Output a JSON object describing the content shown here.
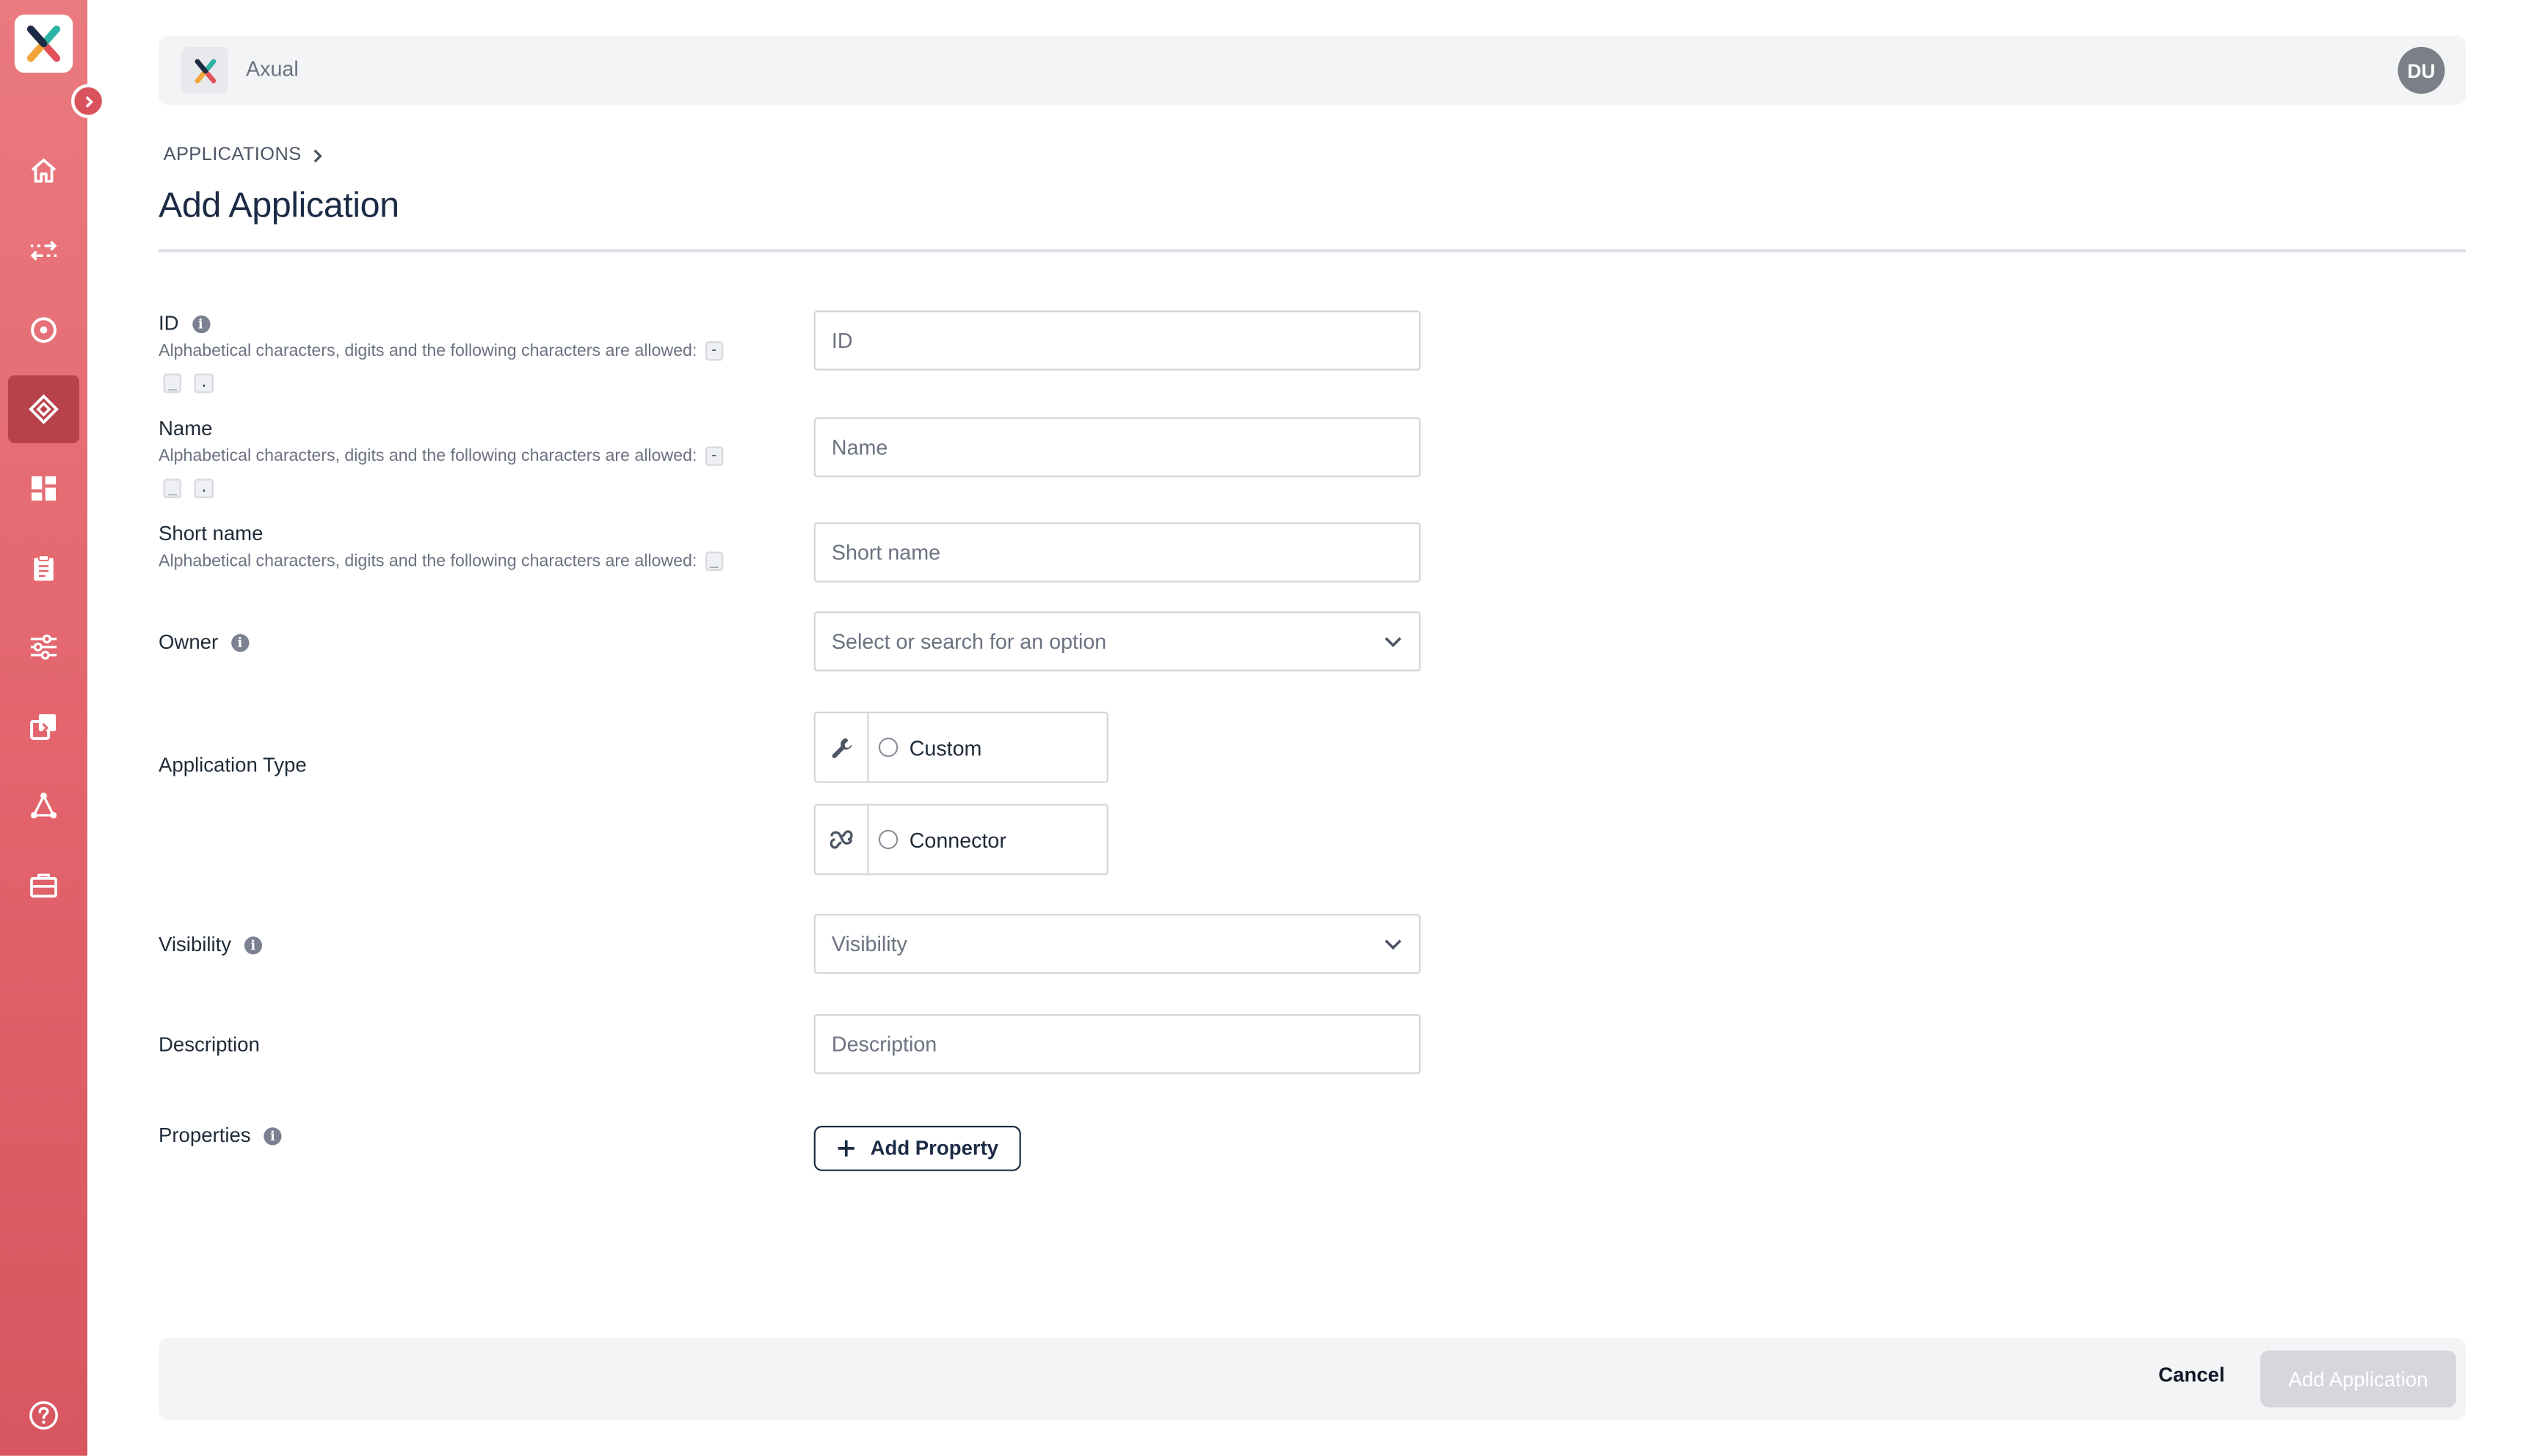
{
  "brand": {
    "app_name": "Axual",
    "accent": "#e2636b",
    "navy": "#1c2b45"
  },
  "user": {
    "initials": "DU"
  },
  "sidebar": {
    "items": [
      {
        "name": "home",
        "icon": "home-icon"
      },
      {
        "name": "streams",
        "icon": "arrows-exchange-icon"
      },
      {
        "name": "topics",
        "icon": "target-icon"
      },
      {
        "name": "applications",
        "icon": "diamond-icon",
        "active": true
      },
      {
        "name": "dashboard",
        "icon": "grid-icon"
      },
      {
        "name": "clipboard",
        "icon": "clipboard-icon"
      },
      {
        "name": "settings",
        "icon": "sliders-icon"
      },
      {
        "name": "copy",
        "icon": "copy-icon"
      },
      {
        "name": "network",
        "icon": "network-icon"
      },
      {
        "name": "toolbox",
        "icon": "toolbox-icon"
      }
    ],
    "help_icon": "help-icon"
  },
  "breadcrumb": {
    "parent": "APPLICATIONS"
  },
  "page": {
    "title": "Add Application"
  },
  "form": {
    "id": {
      "label": "ID",
      "hint": "Alphabetical characters, digits and the following characters are allowed:",
      "chips": [
        "-",
        "_",
        "."
      ],
      "placeholder": "ID"
    },
    "name": {
      "label": "Name",
      "hint": "Alphabetical characters, digits and the following characters are allowed:",
      "chips": [
        "-",
        "_",
        "."
      ],
      "placeholder": "Name"
    },
    "short_name": {
      "label": "Short name",
      "hint": "Alphabetical characters, digits and the following characters are allowed:",
      "chips": [
        "_"
      ],
      "placeholder": "Short name"
    },
    "owner": {
      "label": "Owner",
      "placeholder": "Select or search for an option"
    },
    "application_type": {
      "label": "Application Type",
      "options": [
        {
          "label": "Custom",
          "icon": "wrench-icon"
        },
        {
          "label": "Connector",
          "icon": "plug-icon"
        }
      ]
    },
    "visibility": {
      "label": "Visibility",
      "placeholder": "Visibility"
    },
    "description": {
      "label": "Description",
      "placeholder": "Description"
    },
    "properties": {
      "label": "Properties",
      "add_label": "Add Property"
    }
  },
  "footer": {
    "cancel_label": "Cancel",
    "submit_label": "Add Application"
  }
}
